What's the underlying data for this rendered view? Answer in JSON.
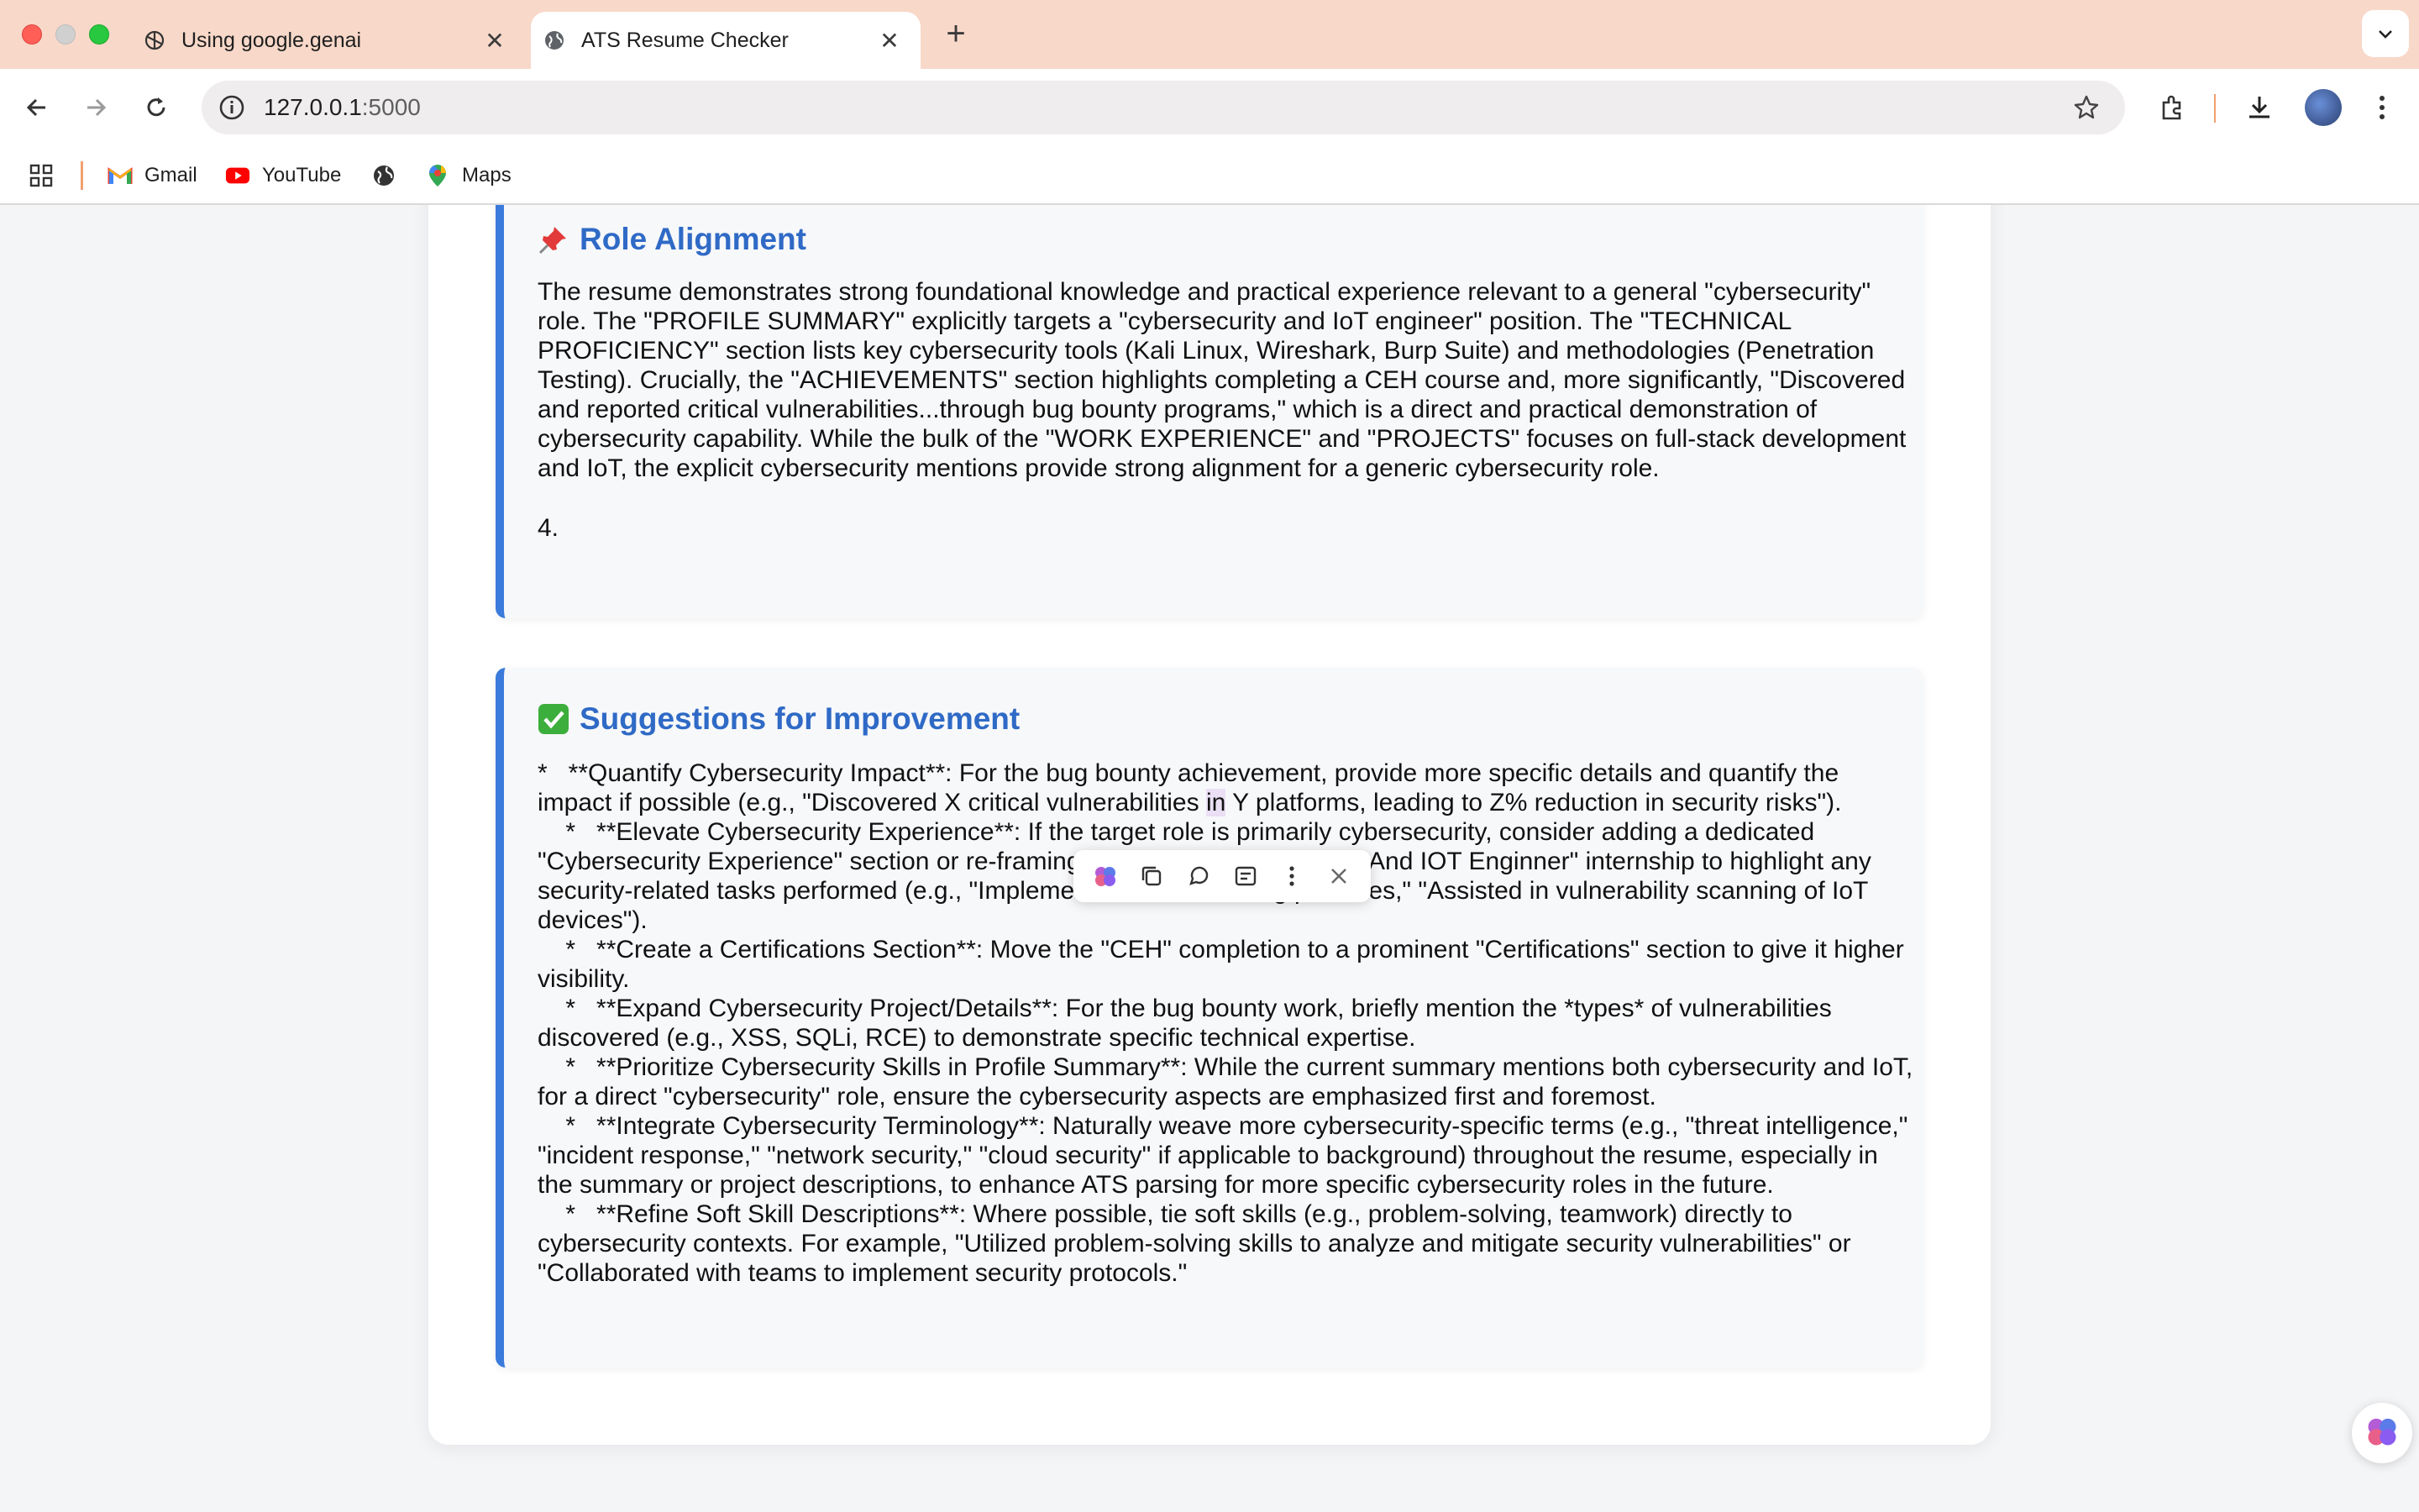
{
  "browser": {
    "tabs": [
      {
        "title": "Using google.genai",
        "favicon": "openai-icon",
        "active": false
      },
      {
        "title": "ATS Resume Checker",
        "favicon": "globe-icon",
        "active": true
      }
    ],
    "url": {
      "host": "127.0.0.1",
      "port": ":5000"
    },
    "bookmarks": [
      {
        "label": "Gmail",
        "icon": "gmail-icon"
      },
      {
        "label": "YouTube",
        "icon": "youtube-icon"
      },
      {
        "label": "",
        "icon": "globe-icon"
      },
      {
        "label": "Maps",
        "icon": "maps-icon"
      }
    ],
    "colors": {
      "tabbar": "#f8d8c9",
      "accent_separator": "#f0a070"
    }
  },
  "page": {
    "role_alignment": {
      "emoji": "📌",
      "title": "Role Alignment",
      "body": "The resume demonstrates strong foundational knowledge and practical experience relevant to a general \"cybersecurity\" role. The \"PROFILE SUMMARY\" explicitly targets a \"cybersecurity and IoT engineer\" position. The \"TECHNICAL PROFICIENCY\" section lists key cybersecurity tools (Kali Linux, Wireshark, Burp Suite) and methodologies (Penetration Testing). Crucially, the \"ACHIEVEMENTS\" section highlights completing a CEH course and, more significantly, \"Discovered and reported critical vulnerabilities...through bug bounty programs,\" which is a direct and practical demonstration of cybersecurity capability. While the bulk of the \"WORK EXPERIENCE\" and \"PROJECTS\" focuses on full-stack development and IoT, the explicit cybersecurity mentions provide strong alignment for a generic cybersecurity role.",
      "number": "4."
    },
    "suggestions": {
      "emoji": "✅",
      "title": "Suggestions for Improvement",
      "line1_pre": "*   **Quantify Cybersecurity Impact**: For the bug bounty achievement, provide more specific details and quantify the impact if possible (e.g., \"Discovered X critical vulnerabilities ",
      "line1_hl": "in",
      "line1_post": " Y platforms, leading to Z% reduction in security risks\").",
      "rest": "    *   **Elevate Cybersecurity Experience**: If the target role is primarily cybersecurity, consider adding a dedicated \"Cybersecurity Experience\" section or re-framing the \"Full stack developer And IOT Enginner\" internship to highlight any security-related tasks performed (e.g., \"Implemented secure coding practices,\" \"Assisted in vulnerability scanning of IoT devices\").\n    *   **Create a Certifications Section**: Move the \"CEH\" completion to a prominent \"Certifications\" section to give it higher visibility.\n    *   **Expand Cybersecurity Project/Details**: For the bug bounty work, briefly mention the *types* of vulnerabilities discovered (e.g., XSS, SQLi, RCE) to demonstrate specific technical expertise.\n    *   **Prioritize Cybersecurity Skills in Profile Summary**: While the current summary mentions both cybersecurity and IoT, for a direct \"cybersecurity\" role, ensure the cybersecurity aspects are emphasized first and foremost.\n    *   **Integrate Cybersecurity Terminology**: Naturally weave more cybersecurity-specific terms (e.g., \"threat intelligence,\" \"incident response,\" \"network security,\" \"cloud security\" if applicable to background) throughout the resume, especially in the summary or project descriptions, to enhance ATS parsing for more specific cybersecurity roles in the future.\n    *   **Refine Soft Skill Descriptions**: Where possible, tie soft skills (e.g., problem-solving, teamwork) directly to cybersecurity contexts. For example, \"Utilized problem-solving skills to analyze and mitigate security vulnerabilities\" or \"Collaborated with teams to implement security protocols.\""
    },
    "colors": {
      "heading": "#2f6ac6",
      "section_border": "#3a7bdc",
      "highlight": "#eadff5"
    }
  },
  "selection_toolbar": {
    "icons": [
      "brain-icon",
      "copy-icon",
      "chat-bubble-icon",
      "summary-icon",
      "more-icon",
      "close-icon"
    ]
  }
}
